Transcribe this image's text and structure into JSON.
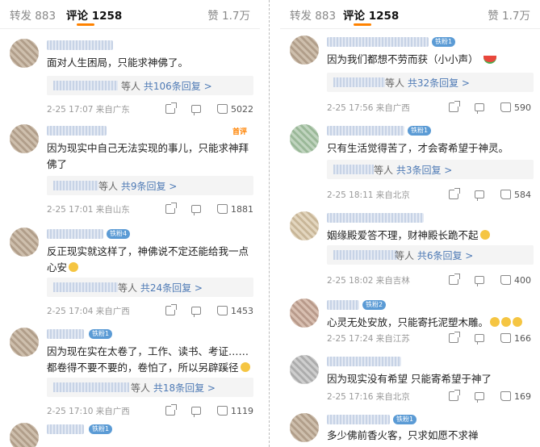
{
  "left": {
    "tabs": {
      "repost": "转发 883",
      "comments": "评论 1258",
      "likes": "赞 1.7万"
    },
    "comments": [
      {
        "text": "面对人生困局，只能求神佛了。",
        "badge": "",
        "hot": "",
        "reply_people": "等人",
        "reply_link": "共106条回复 >",
        "meta": "2-25 17:07 来自广东",
        "likes": "5022"
      },
      {
        "text": "因为现实中自己无法实现的事儿，只能求神拜佛了",
        "badge": "",
        "hot": "首评",
        "reply_people": "等人",
        "reply_link": "共9条回复 >",
        "meta": "2-25 17:01 来自山东",
        "likes": "1881"
      },
      {
        "text": "反正现实就这样了，神佛说不定还能给我一点心安",
        "badge": "铁粉4",
        "hot": "",
        "reply_people": "等人",
        "reply_link": "共24条回复 >",
        "meta": "2-25 17:04 来自广西",
        "likes": "1453"
      },
      {
        "text": "因为现在实在太卷了，工作、读书、考证……都卷得不要不要的，卷怕了，所以另辟蹊径",
        "badge": "铁粉1",
        "hot": "",
        "reply_people": "等人",
        "reply_link": "共18条回复 >",
        "meta": "2-25 17:10 来自广西",
        "likes": "1119"
      },
      {
        "text": "",
        "badge": "铁粉1",
        "hot": "",
        "reply_people": "",
        "reply_link": "",
        "meta": "",
        "likes": ""
      }
    ]
  },
  "right": {
    "tabs": {
      "repost": "转发 883",
      "comments": "评论 1258",
      "likes": "赞 1.7万"
    },
    "comments": [
      {
        "text": "因为我们都想不劳而获（小小声）",
        "badge": "铁粉1",
        "reply_people": "等人",
        "reply_link": "共32条回复 >",
        "meta": "2-25 17:56 来自广西",
        "likes": "590"
      },
      {
        "text": "只有生活觉得苦了，才会寄希望于神灵。",
        "badge": "铁粉1",
        "reply_people": "等人",
        "reply_link": "共3条回复 >",
        "meta": "2-25 18:11 来自北京",
        "likes": "584"
      },
      {
        "text": "姻缘殿爱答不理，财神殿长跪不起",
        "badge": "",
        "reply_people": "等人",
        "reply_link": "共6条回复 >",
        "meta": "2-25 18:02 来自吉林",
        "likes": "400"
      },
      {
        "text": "心灵无处安放，只能寄托泥塑木雕。",
        "badge": "铁粉2",
        "reply_people": "",
        "reply_link": "",
        "meta": "2-25 17:24 来自江苏",
        "likes": "166"
      },
      {
        "text": "因为现实没有希望 只能寄希望于神了",
        "badge": "",
        "reply_people": "",
        "reply_link": "",
        "meta": "2-25 17:16 来自北京",
        "likes": "169"
      },
      {
        "text": "多少佛前香火客，只求如愿不求禅",
        "badge": "铁粉1",
        "reply_people": "",
        "reply_link": "",
        "meta": "",
        "likes": ""
      }
    ]
  },
  "icons": [
    "share-icon",
    "comment-icon",
    "like-icon"
  ]
}
